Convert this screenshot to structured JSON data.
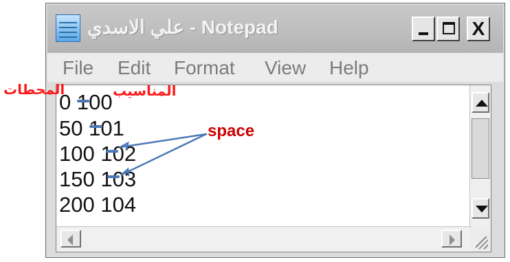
{
  "window": {
    "title": "علي الاسدي - Notepad",
    "menu": [
      "File",
      "Edit",
      "Format",
      "View",
      "Help"
    ],
    "controls": {
      "minimize": "_",
      "maximize": "□",
      "close": "X"
    }
  },
  "editor": {
    "lines": [
      "0 100",
      "50 101",
      "100 102",
      "150 103",
      "200 104"
    ]
  },
  "annotations": {
    "left_label": "المحطات",
    "right_label": "المناسيب",
    "space_label": "space",
    "colors": {
      "red": "#ff1a1a",
      "blue": "#4d78b8"
    }
  }
}
